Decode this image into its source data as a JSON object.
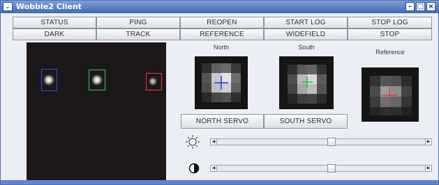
{
  "window": {
    "title": "Wobble2 Client"
  },
  "buttons_row1": [
    "STATUS",
    "PING",
    "REOPEN",
    "START LOG",
    "STOP LOG"
  ],
  "buttons_row2": [
    "DARK",
    "TRACK",
    "REFERENCE",
    "WIDEFIELD",
    "STOP"
  ],
  "panels": {
    "north": "North",
    "south": "South",
    "reference": "Reference"
  },
  "servo": {
    "north": "NORTH SERVO",
    "south": "SOUTH SERVO"
  },
  "sliders": {
    "brightness_level": 0.55,
    "contrast_level": 0.55
  },
  "colors": {
    "blue_box": "#4040d0",
    "green_box": "#30b050",
    "red_box": "#d03a3a"
  }
}
